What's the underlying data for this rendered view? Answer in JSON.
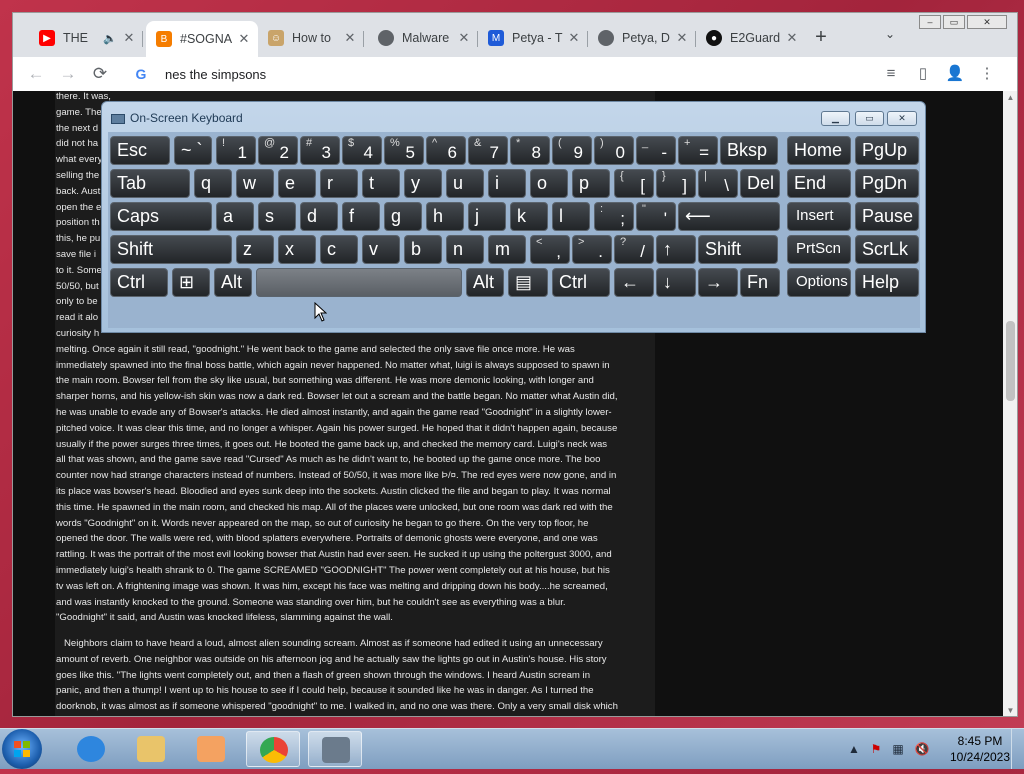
{
  "browser": {
    "tabs": [
      {
        "label": "THE",
        "icon": "youtube-icon",
        "color": "#ff0000",
        "extra_icon": "speaker-icon"
      },
      {
        "label": "#SOGNA",
        "icon": "blogger-icon",
        "color": "#f57d00",
        "active": true
      },
      {
        "label": "How to",
        "icon": "wikihow-icon",
        "color": "#8b6a3e"
      },
      {
        "label": "Malware",
        "icon": "globe-icon",
        "color": "#5f6368"
      },
      {
        "label": "Petya - T",
        "icon": "malwarebytes-icon",
        "color": "#1f5bd8"
      },
      {
        "label": "Petya, D",
        "icon": "globe-icon",
        "color": "#5f6368"
      },
      {
        "label": "E2Guard",
        "icon": "github-icon",
        "color": "#111111"
      }
    ],
    "new_tab": "+",
    "tab_search": "⌄",
    "window_buttons": {
      "minimize": "–",
      "restore": "▭",
      "close": "✕"
    },
    "omnibox": {
      "text": "nes the simpsons",
      "engine_icon": "G"
    },
    "nav": {
      "back": "←",
      "forward": "→",
      "reload": "⟳"
    },
    "toolbar_icons": {
      "reading_list": "≡",
      "side_panel": "▯",
      "profile": "👤",
      "menu": "⋮"
    }
  },
  "article": {
    "left_fragments": [
      "there. It was,",
      "game. The",
      "the next d",
      "did not ha",
      "what every",
      "selling the",
      "back. Aust",
      "open the e",
      "position th",
      "this, he pu",
      "save file i",
      "to it. Some",
      "50/50, but",
      "only to be",
      "read it alo",
      "curiosity h"
    ],
    "para1": [
      "melting. Once again it still read, \"goodnight.\" He went back to the game and selected the only save file once more. He was",
      "immediately spawned into the final boss battle, which again never happened. No matter what, luigi is always supposed to spawn in",
      "the main room. Bowser fell from the sky like usual, but something was different. He was more demonic looking, with longer and",
      "sharper horns, and his yellow-ish skin was now a dark red. Bowser let out a scream and the battle began. No matter what Austin did,",
      "he was unable to evade any of Bowser's attacks. He died almost instantly, and again the game read \"Goodnight\" in a slightly lower-",
      "pitched voice. It was clear this time, and no longer a whisper. Again his power surged. He hoped that it didn't happen again, because",
      "usually if the power surges three times, it goes out. He booted the game back up, and checked the memory card. Luigi's neck was",
      "all that was shown, and the game save read \"Cursed\" As much as he didn't want to, he booted up the game once more. The boo",
      "counter now had strange characters instead of numbers. Instead of 50/50, it was more like Þ/¤. The red eyes were now gone, and in",
      "its place was bowser's head. Bloodied and eyes sunk deep into the sockets. Austin clicked the file and began to play. It was normal",
      "this time. He spawned in the main room, and checked his map. All of the places were unlocked, but one room was dark red with the",
      "words \"Goodnight\" on it. Words never appeared on the map, so out of curiosity he began to go there. On the very top floor, he",
      "opened the door. The walls were red, with blood splatters everywhere. Portraits of demonic ghosts were everyone, and one was",
      "rattling. It was the portrait of the most evil looking bowser that Austin had ever seen. He sucked it up using the poltergust 3000, and",
      "immediately luigi's health shrank to 0. The game SCREAMED \"GOODNIGHT\" The power went completely out at his house, but his",
      "tv was left on. A frightening image was shown. It was him, except his face was melting and dripping down his body....he screamed,",
      "and was instantly knocked to the ground. Someone was standing over him, but he couldn't see as everything was a blur.",
      "\"Goodnight\" it said, and Austin was knocked lifeless, slamming against the wall."
    ],
    "para2": [
      "Neighbors claim to have heard a loud, almost alien sounding scream. Almost as if someone had edited it using an unnecessary",
      "amount of reverb. One neighbor was outside on his afternoon jog and he actually saw the lights go out in Austin's house. His story",
      "goes like this. \"The lights went completely out, and then a flash of green shown through the windows. I heard Austin scream in",
      "panic, and then a thump! I went up to his house to see if I could help, because it sounded like he was in danger. As I turned the",
      "doorknob, it was almost as if someone whispered \"goodnight\" to me. I walked in, and no one was there. Only a very small disk which"
    ]
  },
  "osk": {
    "title": "On-Screen Keyboard",
    "title_buttons": {
      "minimize": "▁",
      "restore": "▭",
      "close": "✕"
    },
    "rows": [
      [
        {
          "main": "Esc"
        },
        {
          "main": "~ `",
          "type": "sym2"
        },
        {
          "top": "!",
          "main": "1"
        },
        {
          "top": "@",
          "main": "2"
        },
        {
          "top": "#",
          "main": "3"
        },
        {
          "top": "$",
          "main": "4"
        },
        {
          "top": "%",
          "main": "5"
        },
        {
          "top": "^",
          "main": "6"
        },
        {
          "top": "&",
          "main": "7"
        },
        {
          "top": "*",
          "main": "8"
        },
        {
          "top": "(",
          "main": "9"
        },
        {
          "top": ")",
          "main": "0"
        },
        {
          "top": "_",
          "main": "-"
        },
        {
          "top": "+",
          "main": "="
        },
        {
          "main": "Bksp"
        },
        {
          "main": "Home"
        },
        {
          "main": "PgUp"
        }
      ],
      [
        {
          "main": "Tab"
        },
        {
          "main": "q"
        },
        {
          "main": "w"
        },
        {
          "main": "e"
        },
        {
          "main": "r"
        },
        {
          "main": "t"
        },
        {
          "main": "y"
        },
        {
          "main": "u"
        },
        {
          "main": "i"
        },
        {
          "main": "o"
        },
        {
          "main": "p"
        },
        {
          "top": "{",
          "main": "["
        },
        {
          "top": "}",
          "main": "]"
        },
        {
          "top": "|",
          "main": "\\"
        },
        {
          "main": "Del"
        },
        {
          "main": "End"
        },
        {
          "main": "PgDn"
        }
      ],
      [
        {
          "main": "Caps"
        },
        {
          "main": "a"
        },
        {
          "main": "s"
        },
        {
          "main": "d"
        },
        {
          "main": "f"
        },
        {
          "main": "g"
        },
        {
          "main": "h"
        },
        {
          "main": "j"
        },
        {
          "main": "k"
        },
        {
          "main": "l"
        },
        {
          "top": ":",
          "main": ";"
        },
        {
          "top": "\"",
          "main": "'"
        },
        {
          "main": "⟵"
        },
        {
          "main": "Insert"
        },
        {
          "main": "Pause"
        }
      ],
      [
        {
          "main": "Shift"
        },
        {
          "main": "z"
        },
        {
          "main": "x"
        },
        {
          "main": "c"
        },
        {
          "main": "v"
        },
        {
          "main": "b"
        },
        {
          "main": "n"
        },
        {
          "main": "m"
        },
        {
          "top": "<",
          "main": ","
        },
        {
          "top": ">",
          "main": "."
        },
        {
          "top": "?",
          "main": "/"
        },
        {
          "main": "↑"
        },
        {
          "main": "Shift"
        },
        {
          "main": "PrtScn"
        },
        {
          "main": "ScrLk"
        }
      ],
      [
        {
          "main": "Ctrl"
        },
        {
          "main": "⊞"
        },
        {
          "main": "Alt"
        },
        {
          "main": ""
        },
        {
          "main": "Alt"
        },
        {
          "main": "▤"
        },
        {
          "main": "Ctrl"
        },
        {
          "main": "←"
        },
        {
          "main": "↓"
        },
        {
          "main": "→"
        },
        {
          "main": "Fn"
        },
        {
          "main": "Options"
        },
        {
          "main": "Help"
        }
      ]
    ]
  },
  "taskbar": {
    "apps": [
      {
        "name": "internet-explorer-icon",
        "color": "#2e86de"
      },
      {
        "name": "file-explorer-icon",
        "color": "#e9c46a"
      },
      {
        "name": "media-player-icon",
        "color": "#f4a261"
      },
      {
        "name": "chrome-icon",
        "color": "#34a853",
        "open": true
      },
      {
        "name": "on-screen-keyboard-icon",
        "color": "#6b7b8c",
        "open": true
      }
    ],
    "tray": {
      "arrow": "▲",
      "time": "8:45 PM",
      "date": "10/24/2023"
    }
  }
}
